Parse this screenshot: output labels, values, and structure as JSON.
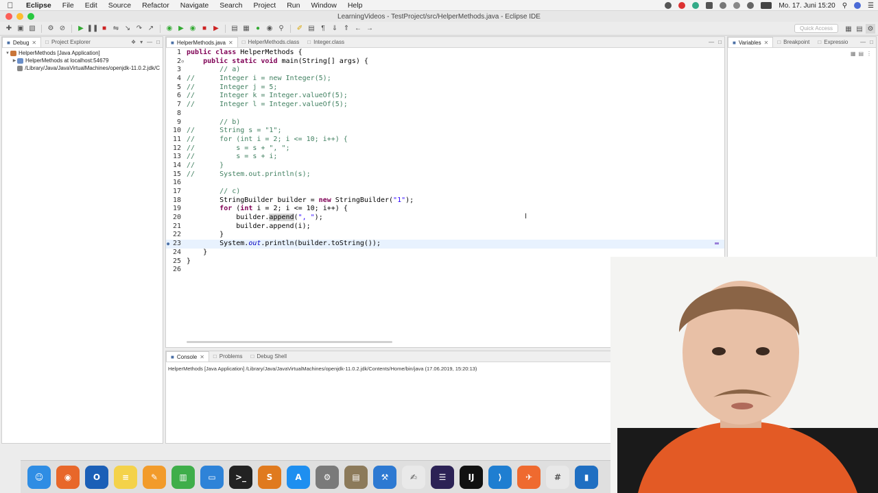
{
  "menubar": {
    "app_name": "Eclipse",
    "items": [
      "File",
      "Edit",
      "Source",
      "Refactor",
      "Navigate",
      "Search",
      "Project",
      "Run",
      "Window",
      "Help"
    ],
    "clock": "Mo. 17. Juni  15:20"
  },
  "window": {
    "title": "LearningVideos - TestProject/src/HelperMethods.java - Eclipse IDE"
  },
  "toolbar": {
    "quick_access_placeholder": "Quick Access"
  },
  "debug_panel": {
    "tabs": [
      {
        "label": "Debug",
        "active": true,
        "icon": "debug-icon"
      },
      {
        "label": "Project Explorer",
        "active": false,
        "icon": "folder-icon"
      }
    ],
    "tree": [
      {
        "label": "HelperMethods [Java Application]",
        "depth": 0,
        "expanded": true,
        "icon": "java-app-icon"
      },
      {
        "label": "HelperMethods at localhost:54679",
        "depth": 1,
        "expanded": false,
        "icon": "process-icon"
      },
      {
        "label": "/Library/Java/JavaVirtualMachines/openjdk-11.0.2.jdk/C",
        "depth": 1,
        "expanded": false,
        "icon": "jvm-icon"
      }
    ]
  },
  "editor": {
    "tabs": [
      {
        "label": "HelperMethods.java",
        "active": true
      },
      {
        "label": "HelperMethods.class",
        "active": false
      },
      {
        "label": "Integer.class",
        "active": false
      }
    ],
    "current_line": 23,
    "lines": [
      [
        {
          "t": "kw",
          "v": "public class "
        },
        {
          "t": "",
          "v": "HelperMethods {"
        }
      ],
      [
        {
          "t": "",
          "v": "    "
        },
        {
          "t": "kw",
          "v": "public static void "
        },
        {
          "t": "",
          "v": "main(String[] args) {"
        }
      ],
      [
        {
          "t": "cm",
          "v": "        // a)"
        }
      ],
      [
        {
          "t": "cm",
          "v": "//      Integer i = new Integer(5);"
        }
      ],
      [
        {
          "t": "cm",
          "v": "//      Integer j = 5;"
        }
      ],
      [
        {
          "t": "cm",
          "v": "//      Integer k = Integer.valueOf(5);"
        }
      ],
      [
        {
          "t": "cm",
          "v": "//      Integer l = Integer.valueOf(5);"
        }
      ],
      [],
      [
        {
          "t": "cm",
          "v": "        // b)"
        }
      ],
      [
        {
          "t": "cm",
          "v": "//      String s = \"1\";"
        }
      ],
      [
        {
          "t": "cm",
          "v": "//      for (int i = 2; i <= 10; i++) {"
        }
      ],
      [
        {
          "t": "cm",
          "v": "//          s = s + \", \";"
        }
      ],
      [
        {
          "t": "cm",
          "v": "//          s = s + i;"
        }
      ],
      [
        {
          "t": "cm",
          "v": "//      }"
        }
      ],
      [
        {
          "t": "cm",
          "v": "//      System.out.println(s);"
        }
      ],
      [],
      [
        {
          "t": "cm",
          "v": "        // c)"
        }
      ],
      [
        {
          "t": "",
          "v": "        StringBuilder builder = "
        },
        {
          "t": "kw",
          "v": "new "
        },
        {
          "t": "",
          "v": "StringBuilder("
        },
        {
          "t": "str",
          "v": "\"1\""
        },
        {
          "t": "",
          "v": ");"
        }
      ],
      [
        {
          "t": "",
          "v": "        "
        },
        {
          "t": "kw",
          "v": "for "
        },
        {
          "t": "",
          "v": "("
        },
        {
          "t": "kw",
          "v": "int "
        },
        {
          "t": "",
          "v": "i = 2; i <= 10; i++) {"
        }
      ],
      [
        {
          "t": "",
          "v": "            builder."
        },
        {
          "t": "hl",
          "v": "append"
        },
        {
          "t": "",
          "v": "("
        },
        {
          "t": "str",
          "v": "\", \""
        },
        {
          "t": "",
          "v": ");"
        }
      ],
      [
        {
          "t": "",
          "v": "            builder.append(i);"
        }
      ],
      [
        {
          "t": "",
          "v": "        }"
        }
      ],
      [
        {
          "t": "",
          "v": "        System."
        },
        {
          "t": "fld",
          "v": "out"
        },
        {
          "t": "",
          "v": ".println(builder.toString());"
        }
      ],
      [
        {
          "t": "",
          "v": "    }"
        }
      ],
      [
        {
          "t": "",
          "v": "}"
        }
      ],
      []
    ]
  },
  "variables_panel": {
    "tabs": [
      {
        "label": "Variables",
        "active": true
      },
      {
        "label": "Breakpoint",
        "active": false
      },
      {
        "label": "Expressio",
        "active": false
      }
    ]
  },
  "console_panel": {
    "tabs": [
      {
        "label": "Console",
        "active": true
      },
      {
        "label": "Problems",
        "active": false
      },
      {
        "label": "Debug Shell",
        "active": false
      }
    ],
    "header": "HelperMethods [Java Application] /Library/Java/JavaVirtualMachines/openjdk-11.0.2.jdk/Contents/Home/bin/java (17.06.2019, 15:20:13)"
  },
  "dock": {
    "apps": [
      {
        "name": "finder",
        "color": "#2f8de4",
        "glyph": "☺"
      },
      {
        "name": "firefox",
        "color": "#e8672a",
        "glyph": "◉"
      },
      {
        "name": "outlook",
        "color": "#1b5fb7",
        "glyph": "O"
      },
      {
        "name": "notes",
        "color": "#f4d24a",
        "glyph": "≡"
      },
      {
        "name": "pages",
        "color": "#f29b2a",
        "glyph": "✎"
      },
      {
        "name": "numbers",
        "color": "#3fae4a",
        "glyph": "▥"
      },
      {
        "name": "keynote",
        "color": "#2e83d8",
        "glyph": "▭"
      },
      {
        "name": "terminal",
        "color": "#222222",
        "glyph": ">_"
      },
      {
        "name": "sublime",
        "color": "#e07a1e",
        "glyph": "S"
      },
      {
        "name": "app-store",
        "color": "#1e8ff0",
        "glyph": "A"
      },
      {
        "name": "system-preferences",
        "color": "#7a7a7a",
        "glyph": "⚙"
      },
      {
        "name": "archive-utility",
        "color": "#8c7a5a",
        "glyph": "▤"
      },
      {
        "name": "xcode",
        "color": "#2d79d2",
        "glyph": "⚒"
      },
      {
        "name": "textedit",
        "color": "#e9e9e9",
        "glyph": "✍"
      },
      {
        "name": "eclipse",
        "color": "#2c2255",
        "glyph": "☰"
      },
      {
        "name": "intellij",
        "color": "#111111",
        "glyph": "IJ"
      },
      {
        "name": "vscode",
        "color": "#1f7ed1",
        "glyph": "⟩"
      },
      {
        "name": "postman",
        "color": "#ef6a2f",
        "glyph": "✈"
      },
      {
        "name": "slack",
        "color": "#e8e8e8",
        "glyph": "#"
      },
      {
        "name": "trello",
        "color": "#1f6fc2",
        "glyph": "▮"
      }
    ]
  }
}
